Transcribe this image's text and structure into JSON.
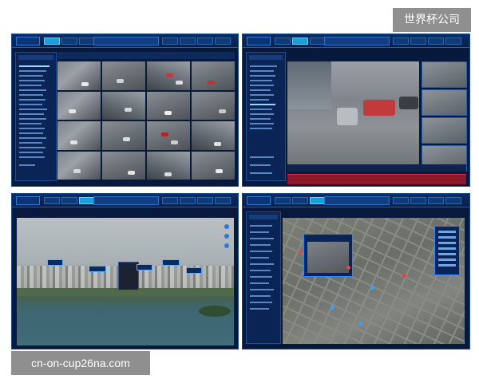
{
  "watermarks": {
    "top_right": "世界杯公司",
    "bottom_left": "cn-on-cup26na.com"
  },
  "panels": [
    {
      "name": "video-wall-panel"
    },
    {
      "name": "playback-panel"
    },
    {
      "name": "aerial-view-panel"
    },
    {
      "name": "map-panel"
    }
  ],
  "colors": {
    "frame_bg": "#071a3d",
    "accent": "#1b5fb3",
    "active_tab": "#19a0d8",
    "timeline": "#8a1826"
  },
  "icons": [
    "logo-icon",
    "map-pin-icon",
    "camera-icon"
  ]
}
